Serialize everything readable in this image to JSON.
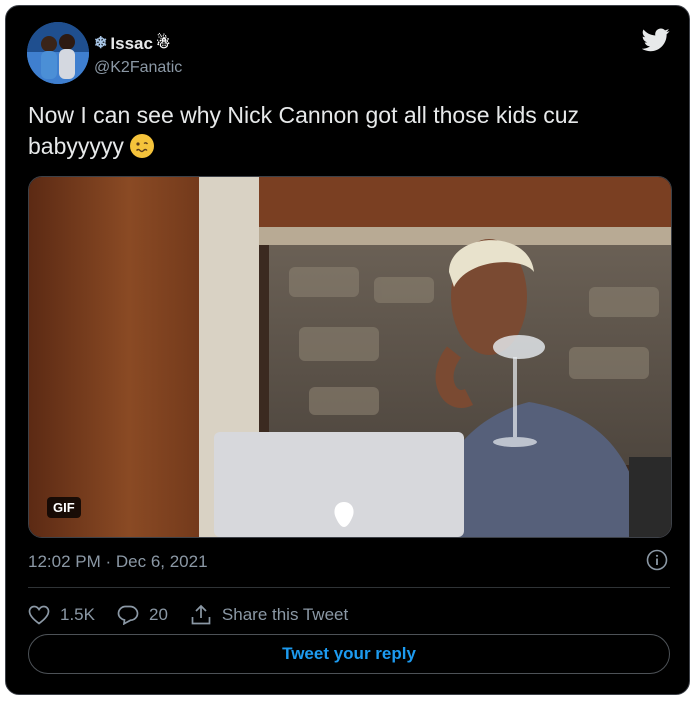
{
  "author": {
    "display_name": "Issac",
    "name_prefix_emoji": "❄",
    "name_suffix_emoji": "☃",
    "handle": "@K2Fanatic"
  },
  "tweet": {
    "text": "Now I can see why Nick Cannon got all those kids cuz babyyyyy",
    "timestamp": "12:02 PM · Dec 6, 2021"
  },
  "media": {
    "badge": "GIF"
  },
  "stats": {
    "likes": "1.5K",
    "replies": "20",
    "share_label": "Share this Tweet"
  },
  "reply_button": {
    "label": "Tweet your reply"
  },
  "colors": {
    "background": "#000000",
    "text": "#e7e9ea",
    "secondary_text": "#8b98a5",
    "accent": "#1d9bf0",
    "border": "#3d4148"
  }
}
